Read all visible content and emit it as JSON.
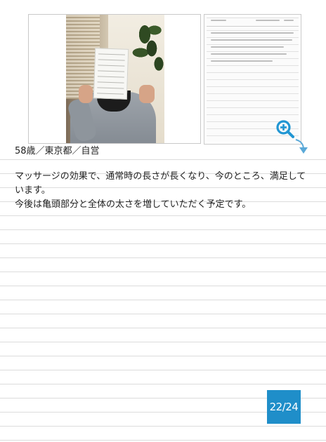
{
  "profile": {
    "info": "58歳／東京都／自営"
  },
  "message": {
    "lines": [
      "マッサージの効果で、通常時の長さが長くなり、今のところ、満足しています。",
      "今後は亀頭部分と全体の太さを増していただく予定です。"
    ]
  },
  "zoom": {
    "icon": "zoom-in-icon"
  },
  "pager": {
    "label": "22/24"
  },
  "colors": {
    "accent": "#1f8ec9",
    "zoom_icon": "#2196d3",
    "rule_line": "#dcdcdc"
  }
}
